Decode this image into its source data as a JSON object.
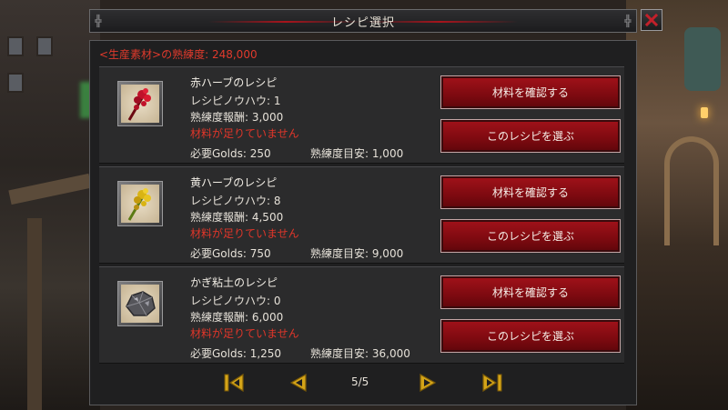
{
  "window": {
    "title": "レシピ選択"
  },
  "panel": {
    "proficiency_text": "<生産素材>の熟練度: 248,000"
  },
  "recipes": [
    {
      "name": "赤ハーブのレシピ",
      "knowhow": "レシピノウハウ: 1",
      "reward": "熟練度報酬: 3,000",
      "warning": "材料が足りていません",
      "golds": "必要Golds: 250",
      "guide": "熟練度目安: 1,000",
      "confirm_label": "材料を確認する",
      "select_label": "このレシピを選ぶ",
      "icon": "red-herb-icon",
      "icon_color": "#c0122a"
    },
    {
      "name": "黄ハーブのレシピ",
      "knowhow": "レシピノウハウ: 8",
      "reward": "熟練度報酬: 4,500",
      "warning": "材料が足りていません",
      "golds": "必要Golds: 750",
      "guide": "熟練度目安: 9,000",
      "confirm_label": "材料を確認する",
      "select_label": "このレシピを選ぶ",
      "icon": "yellow-herb-icon",
      "icon_color": "#d9b414"
    },
    {
      "name": "かぎ粘土のレシピ",
      "knowhow": "レシピノウハウ: 0",
      "reward": "熟練度報酬: 6,000",
      "warning": "材料が足りていません",
      "golds": "必要Golds: 1,250",
      "guide": "熟練度目安: 36,000",
      "confirm_label": "材料を確認する",
      "select_label": "このレシピを選ぶ",
      "icon": "clay-ore-icon",
      "icon_color": "#6b6b70"
    }
  ],
  "pager": {
    "page_text": "5/5",
    "icons": [
      "first-page-icon",
      "prev-page-icon",
      "next-page-icon",
      "last-page-icon"
    ],
    "arrow_color": "#d4a418",
    "current_page": 5,
    "total_pages": 5
  },
  "colors": {
    "accent_red": "#a2121a",
    "warning_red": "#e0362a"
  }
}
